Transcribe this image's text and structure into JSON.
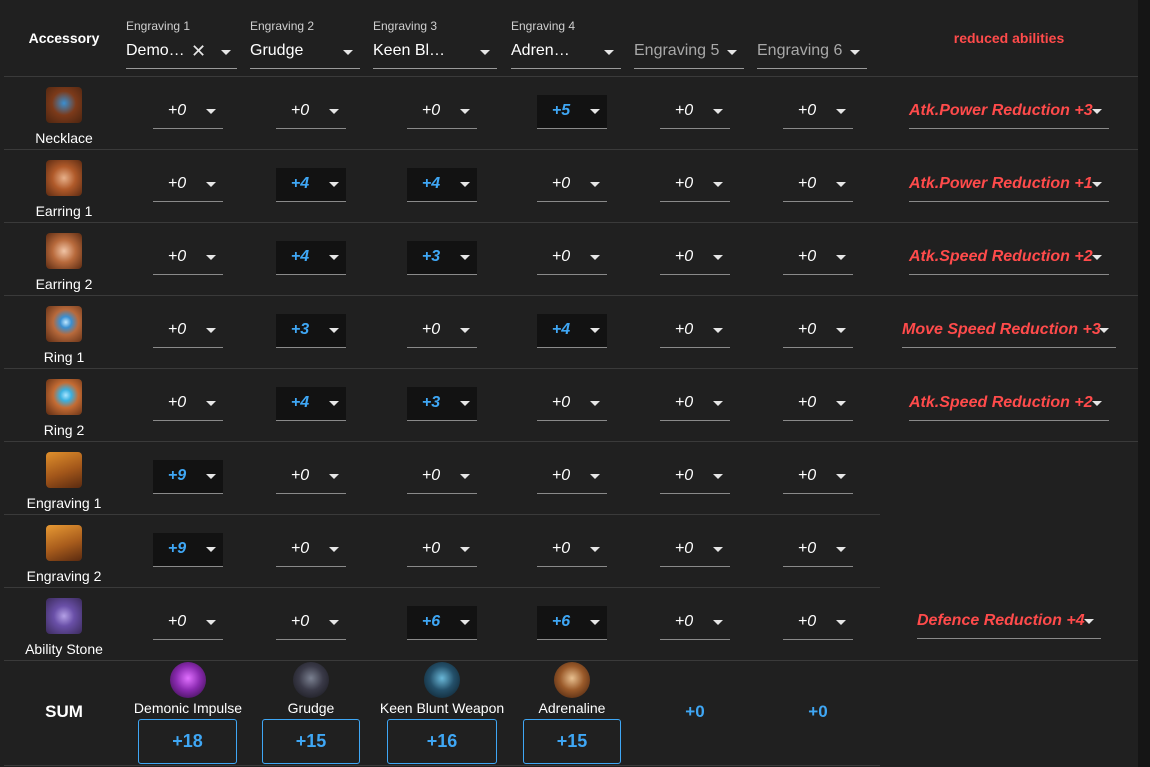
{
  "header": {
    "accessory_label": "Accessory",
    "reduced_label": "reduced abilities",
    "engravings": [
      {
        "small": "Engraving 1",
        "value": "Demo…",
        "clearable": true
      },
      {
        "small": "Engraving 2",
        "value": "Grudge"
      },
      {
        "small": "Engraving 3",
        "value": "Keen Bl…"
      },
      {
        "small": "Engraving 4",
        "value": "Adren…"
      },
      {
        "small": "",
        "placeholder": "Engraving 5"
      },
      {
        "small": "",
        "placeholder": "Engraving 6"
      }
    ]
  },
  "rows": [
    {
      "label": "Necklace",
      "icon": "necklace-icon",
      "values": [
        "+0",
        "+0",
        "+0",
        "+5",
        "+0",
        "+0"
      ],
      "reduced": "Atk.Power Reduction +3"
    },
    {
      "label": "Earring 1",
      "icon": "earring-icon",
      "values": [
        "+0",
        "+4",
        "+4",
        "+0",
        "+0",
        "+0"
      ],
      "reduced": "Atk.Power Reduction +1"
    },
    {
      "label": "Earring 2",
      "icon": "earring-icon",
      "values": [
        "+0",
        "+4",
        "+3",
        "+0",
        "+0",
        "+0"
      ],
      "reduced": "Atk.Speed Reduction +2"
    },
    {
      "label": "Ring 1",
      "icon": "ring-icon",
      "values": [
        "+0",
        "+3",
        "+0",
        "+4",
        "+0",
        "+0"
      ],
      "reduced": "Move Speed Reduction +3"
    },
    {
      "label": "Ring 2",
      "icon": "ring-icon",
      "values": [
        "+0",
        "+4",
        "+3",
        "+0",
        "+0",
        "+0"
      ],
      "reduced": "Atk.Speed Reduction +2"
    },
    {
      "label": "Engraving 1",
      "icon": "engraving-book-icon",
      "values": [
        "+9",
        "+0",
        "+0",
        "+0",
        "+0",
        "+0"
      ],
      "reduced": ""
    },
    {
      "label": "Engraving 2",
      "icon": "engraving-book-icon",
      "values": [
        "+9",
        "+0",
        "+0",
        "+0",
        "+0",
        "+0"
      ],
      "reduced": ""
    },
    {
      "label": "Ability Stone",
      "icon": "ability-stone-icon",
      "values": [
        "+0",
        "+0",
        "+6",
        "+6",
        "+0",
        "+0"
      ],
      "reduced": "Defence Reduction +4"
    }
  ],
  "sum": {
    "label": "SUM",
    "items": [
      {
        "name": "Demonic Impulse",
        "total": "+18",
        "icon": "demonic-impulse-icon"
      },
      {
        "name": "Grudge",
        "total": "+15",
        "icon": "grudge-icon"
      },
      {
        "name": "Keen Blunt Weapon",
        "total": "+16",
        "icon": "keen-blunt-weapon-icon"
      },
      {
        "name": "Adrenaline",
        "total": "+15",
        "icon": "adrenaline-icon"
      },
      {
        "name": "",
        "total": "+0"
      },
      {
        "name": "",
        "total": "+0"
      }
    ]
  },
  "colors": {
    "accent": "#3fa7f5",
    "warning": "#ff4b4b",
    "background": "#202020"
  }
}
